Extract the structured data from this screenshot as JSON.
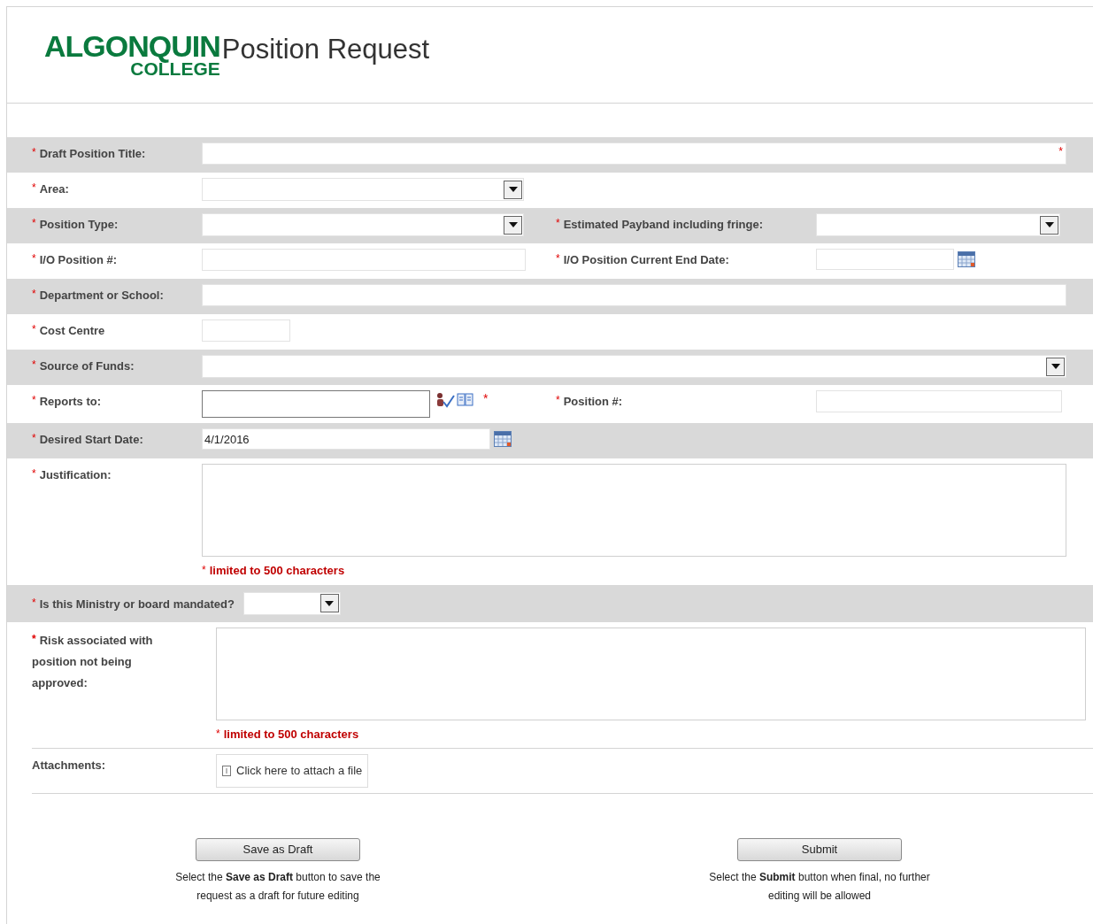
{
  "header": {
    "logo_wordmark": "ALGONQUIN",
    "logo_subtitle": "COLLEGE",
    "title": "Position Request"
  },
  "rows": [
    {
      "shaded": true,
      "fields": [
        {
          "mark": "*",
          "label": "Draft Position Title:",
          "kind": "text",
          "trailing_mark": "*"
        }
      ]
    },
    {
      "shaded": false,
      "fields": [
        {
          "mark": "*",
          "label": "Area:",
          "kind": "select"
        }
      ]
    },
    {
      "shaded": true,
      "fields": [
        {
          "mark": "*",
          "label": "Position Type:",
          "kind": "select"
        },
        {
          "mark": "*",
          "label": "Estimated Payband including fringe:",
          "kind": "select"
        }
      ]
    },
    {
      "shaded": false,
      "fields": [
        {
          "mark": "*",
          "label": "I/O Position #:",
          "kind": "text"
        },
        {
          "mark": "*",
          "label": "I/O Position Current End Date:",
          "kind": "date"
        }
      ]
    },
    {
      "shaded": true,
      "fields": [
        {
          "mark": "*",
          "label": "Department or School:",
          "kind": "text"
        }
      ]
    },
    {
      "shaded": false,
      "fields": [
        {
          "mark": "*",
          "label": "Cost Centre",
          "kind": "text"
        }
      ]
    },
    {
      "shaded": true,
      "fields": [
        {
          "mark": "*",
          "label": "Source of Funds:",
          "kind": "select"
        }
      ]
    },
    {
      "shaded": false,
      "fields": [
        {
          "mark": "*",
          "label": "Reports to:",
          "kind": "people",
          "trailing_mark": "*"
        },
        {
          "mark": "*",
          "label": "Position #:",
          "kind": "text"
        }
      ]
    },
    {
      "shaded": true,
      "fields": [
        {
          "mark": "*",
          "label": "Desired Start Date:",
          "kind": "date",
          "value": "4/1/2016"
        }
      ]
    },
    {
      "shaded": false,
      "fields": [
        {
          "mark": "*",
          "label": "Justification:",
          "kind": "textarea",
          "note": {
            "mark": "*",
            "text": "limited to 500 characters"
          }
        }
      ]
    },
    {
      "shaded": true,
      "fields": [
        {
          "mark": "*",
          "label": "Is this Ministry or board mandated?",
          "kind": "inline_select"
        }
      ]
    },
    {
      "shaded": false,
      "fields": [
        {
          "mark": "*",
          "label": "Risk associated with position not being approved:",
          "kind": "wide_textarea",
          "note": {
            "mark": "*",
            "text": "limited to 500 characters"
          }
        }
      ]
    },
    {
      "shaded": false,
      "fields": [
        {
          "label": "Attachments:",
          "kind": "attach",
          "action": "Click here to attach a file"
        }
      ]
    }
  ],
  "actions": [
    {
      "button": "Save as Draft",
      "help": "Select the **Save as Draft** button to save the request as a draft for future editing"
    },
    {
      "button": "Submit",
      "help": "Select the **Submit** button when final, no further editing will be allowed"
    }
  ]
}
